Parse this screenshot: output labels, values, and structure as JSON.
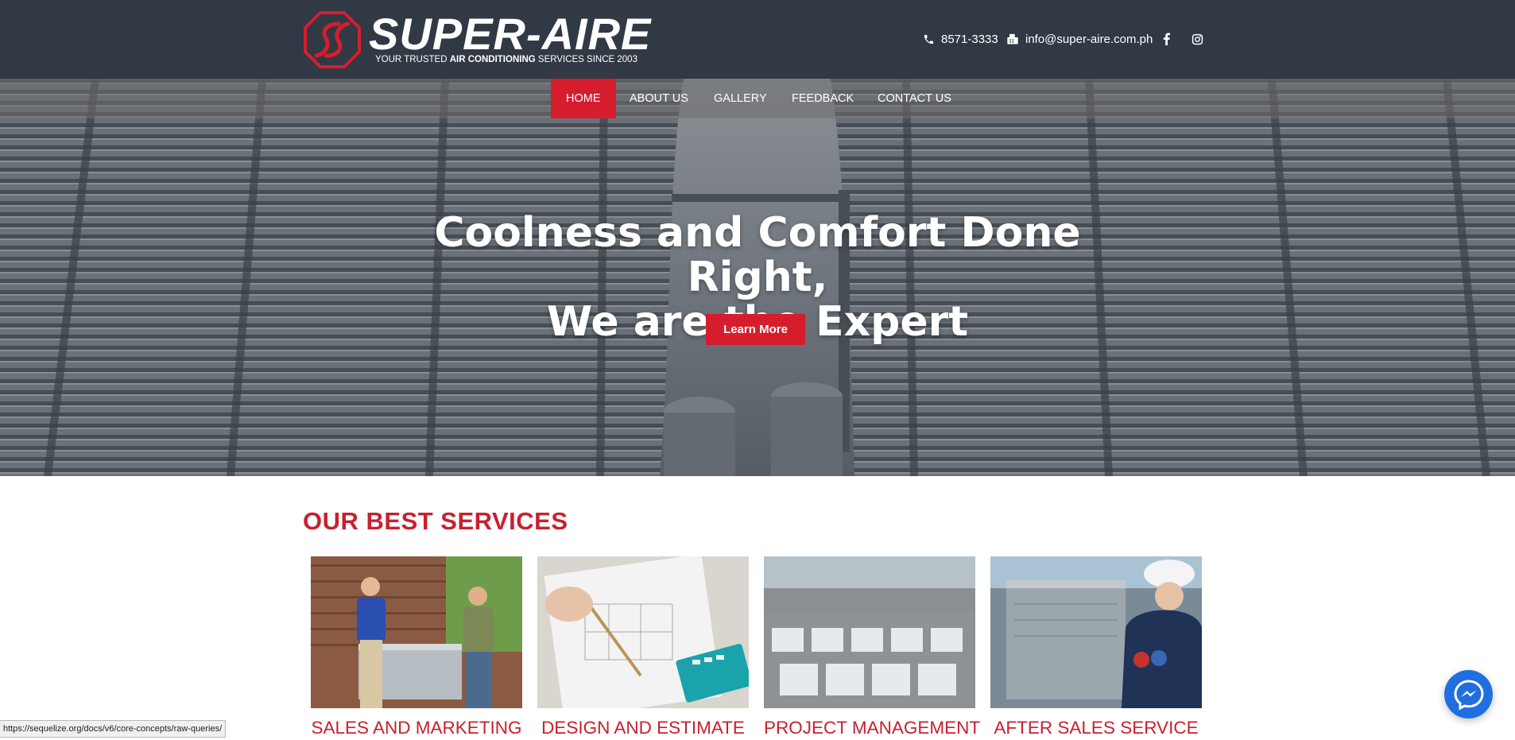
{
  "header": {
    "brand": "SUPER-AIRE",
    "tagline_before": "YOUR TRUSTED ",
    "tagline_bold": "AIR CONDITIONING",
    "tagline_after": " SERVICES SINCE 2003",
    "phone": "8571-3333",
    "email": "info@super-aire.com.ph",
    "brand_color": "#d61d2e",
    "background_color": "#303944",
    "icons": [
      "phone-icon",
      "fax-icon",
      "facebook-icon",
      "instagram-icon"
    ]
  },
  "nav": {
    "items": [
      {
        "label": "HOME",
        "active": true
      },
      {
        "label": "ABOUT US",
        "active": false
      },
      {
        "label": "GALLERY",
        "active": false
      },
      {
        "label": "FEEDBACK",
        "active": false
      },
      {
        "label": "CONTACT US",
        "active": false
      }
    ]
  },
  "hero": {
    "title_line1": "Coolness and Comfort Done Right,",
    "title_line2": "We are the Expert",
    "button_label": "Learn More"
  },
  "services": {
    "heading": "OUR BEST SERVICES",
    "items": [
      {
        "title": "SALES AND MARKETING"
      },
      {
        "title": "DESIGN AND ESTIMATE"
      },
      {
        "title": "PROJECT MANAGEMENT"
      },
      {
        "title": "AFTER SALES SERVICE"
      }
    ]
  },
  "status_bar": {
    "url": "https://sequelize.org/docs/v6/core-concepts/raw-queries/"
  },
  "chat": {
    "icon": "messenger-icon",
    "color": "#1f6fe0"
  }
}
